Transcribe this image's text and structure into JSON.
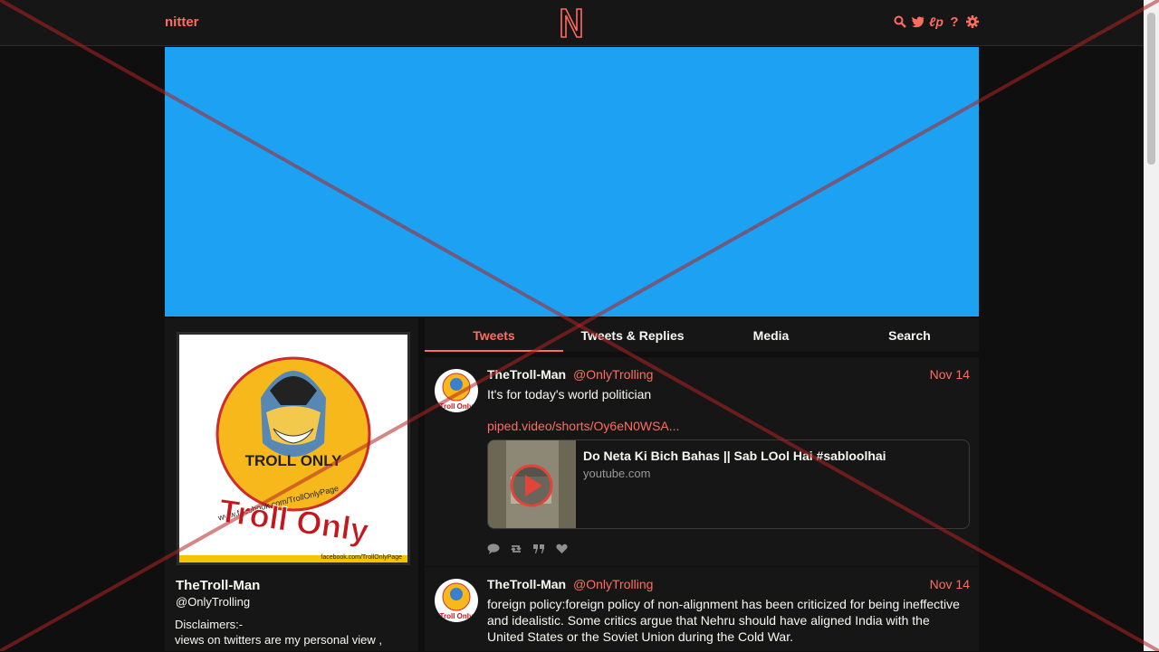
{
  "nav": {
    "brand": "nitter",
    "icons": [
      "search-icon",
      "twitter-icon",
      "rss-icon",
      "help-icon",
      "gear-icon"
    ]
  },
  "profile": {
    "fullname": "TheTroll-Man",
    "username": "@OnlyTrolling",
    "bio": "Disclaimers:-\nviews on twitters are my personal view ,",
    "avatar_text": {
      "badge": "TROLL ONLY",
      "arc": "www.facebook.com/TrollOnlyPage",
      "big": "Troll Only",
      "strip": "facebook.com/TrollOnlyPage"
    }
  },
  "tabs": [
    {
      "label": "Tweets",
      "active": true
    },
    {
      "label": "Tweets & Replies",
      "active": false
    },
    {
      "label": "Media",
      "active": false
    },
    {
      "label": "Search",
      "active": false
    }
  ],
  "tweets": [
    {
      "fullname": "TheTroll-Man",
      "username": "@OnlyTrolling",
      "date": "Nov 14",
      "text": "It's for today's world politician",
      "link": "piped.video/shorts/Oy6eN0WSA...",
      "card": {
        "title": "Do Neta Ki Bich Bahas || Sab LOol Hai #sabloolhai",
        "destination": "youtube.com"
      },
      "stats": [
        "comment-icon",
        "retweet-icon",
        "quote-icon",
        "heart-icon"
      ]
    },
    {
      "fullname": "TheTroll-Man",
      "username": "@OnlyTrolling",
      "date": "Nov 14",
      "text": "foreign policy:foreign policy of non-alignment has been criticized for being ineffective and idealistic. Some critics argue that Nehru should have aligned India with the United States or the Soviet Union during the Cold War."
    }
  ],
  "colors": {
    "accent": "#ff6c60",
    "banner": "#1da1f2",
    "background": "#0f0f0f",
    "panel": "#161616",
    "cross": "#b22222"
  }
}
